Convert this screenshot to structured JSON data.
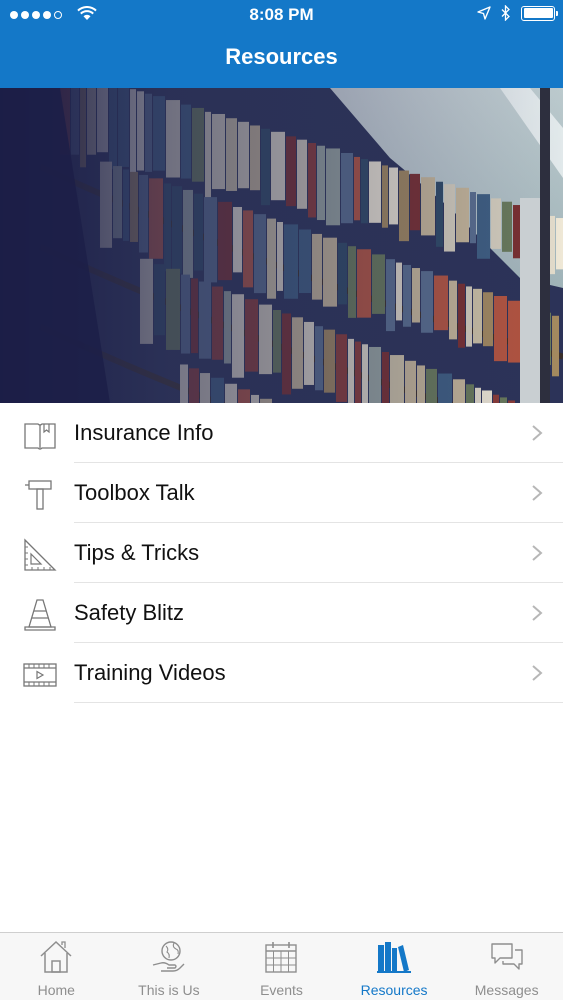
{
  "status_bar": {
    "time": "8:08 PM"
  },
  "header": {
    "title": "Resources"
  },
  "menu": {
    "items": [
      {
        "label": "Insurance Info",
        "icon": "book-icon"
      },
      {
        "label": "Toolbox Talk",
        "icon": "hammer-icon"
      },
      {
        "label": "Tips & Tricks",
        "icon": "set-square-icon"
      },
      {
        "label": "Safety Blitz",
        "icon": "traffic-cone-icon"
      },
      {
        "label": "Training Videos",
        "icon": "video-icon"
      }
    ]
  },
  "tab_bar": {
    "tabs": [
      {
        "label": "Home",
        "icon": "home-icon"
      },
      {
        "label": "This is Us",
        "icon": "globe-hand-icon"
      },
      {
        "label": "Events",
        "icon": "calendar-icon"
      },
      {
        "label": "Resources",
        "icon": "books-icon"
      },
      {
        "label": "Messages",
        "icon": "chat-icon"
      }
    ],
    "active": "Resources"
  },
  "colors": {
    "brand": "#1478c8",
    "inactive": "#8e8e8e"
  }
}
